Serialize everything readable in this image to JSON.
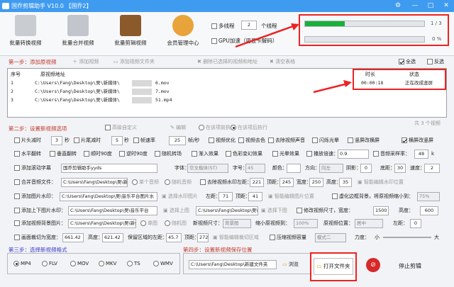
{
  "window": {
    "title": "国乔剪辑助手 V10.0   【国乔2】",
    "btn_settings": "⚙",
    "btn_min": "—",
    "btn_max": "□",
    "btn_close": "✕"
  },
  "toolbar": {
    "tools": [
      "批量转换视频",
      "批量合并视频",
      "批量剪辑视频",
      "会员管理中心"
    ],
    "multithread_label": "多线程",
    "thread_count": "2",
    "thread_unit": "个线程",
    "gpu_label": "GPU加速（用显卡解码）"
  },
  "progress": {
    "overall_fraction": 0.333,
    "overall_text": "1 / 3",
    "current_fraction": 0.0,
    "current_text": "0 %"
  },
  "step1": {
    "title": "第一步：添加原视频",
    "add_video": "添加视频",
    "add_folder": "添加视频文件夹",
    "delete_selected": "删除已选择的视频和地址",
    "clear_list": "清空表格",
    "select_all": "全选",
    "invert": "反选"
  },
  "list": {
    "headers": [
      "序号",
      "原视频地址",
      "时长",
      "状态"
    ],
    "rows": [
      {
        "index": "1",
        "path": "C:\\Users\\Fang\\Desktop\\吴\\新媒体\\",
        "suffix": "6.mov",
        "duration": "00:00:18",
        "status": "正在改成竖屏"
      },
      {
        "index": "2",
        "path": "C:\\Users\\Fang\\Desktop\\吴\\新媒体\\",
        "suffix": "7.mov",
        "duration": "",
        "status": ""
      },
      {
        "index": "3",
        "path": "C:\\Users\\Fang\\Desktop\\吴\\新媒体\\",
        "suffix": "51.mp4",
        "duration": "",
        "status": ""
      }
    ],
    "count_text": "共 3 个视频"
  },
  "step2": {
    "title": "第二步：设置新视频选项",
    "advanced": "高级自定义",
    "edit": "编辑",
    "before": "在该项前执行",
    "after": "在该项后执行"
  },
  "opts": {
    "cut_head": "片头减时",
    "cut_head_val": "3",
    "sec": "秒",
    "cut_tail": "片尾减时",
    "cut_tail_val": "5",
    "fps_label": "帧速率",
    "fps_val": "25",
    "fps_unit": "帧/秒",
    "optimize": "视频优化",
    "decolor": "视频去色",
    "remove_audio": "去除视频声音",
    "flash": "闪烁光晕",
    "portrait_h": "竖屏改横屏",
    "landscape_p": "横屏改竖屏",
    "hflip": "水平翻转",
    "vflip": "垂直翻转",
    "rot90cw": "顺时90度",
    "rot90ccw": "逆时90度",
    "rand_transition": "随机转场",
    "fade_in": "渐入效果",
    "color_change": "色彩变幻效果",
    "light_effect": "光晕效果",
    "speed_label": "播放倍速：",
    "speed_val": "0.9",
    "samplerate_label": "音频采样率：",
    "samplerate_val": "48",
    "samplerate_unit": "k",
    "scroll_sub": "添加滚动字幕",
    "scroll_text": "国乔剪辑助手yyds",
    "font_label": "字体：",
    "font_val": "华文楷体(ST)",
    "fontsize_label": "字号：",
    "fontsize_val": "45",
    "color_label": "颜色：",
    "dir_label": "方向：",
    "dir_val": "向左",
    "shadow_label": "阴影：",
    "shadow_val": "0",
    "bottom_label": "底距：",
    "bottom_val": "30",
    "speed2_label": "速度：",
    "speed2_val": "2",
    "merge_audio": "合并音频文件：",
    "merge_path": "C:\\Users\\Fang\\Desktop\\吴\\新媒",
    "single_audio": "单个音频",
    "random_audio": "随机音频",
    "remove_wm": "去除视频水印",
    "left_label": "左距：",
    "left_val": "221",
    "top_label": "顶距：",
    "top_val": "245",
    "width_label": "宽度：",
    "width_val": "250",
    "height_label": "高度：",
    "height_val": "35",
    "smart_wm": "智能编辑水印位置",
    "add_pic_wm": "添加图片水印：",
    "pic_wm_path": "C:\\Users\\Fang\\Desktop\\吴\\音乐平台图片水",
    "choose_wm": "选择水印图片",
    "wm_left": "71",
    "wm_top": "41",
    "smart_pic": "智能编辑图片位置",
    "blur_bg": "虚化边框背景，将原视频缩小到：",
    "blur_val": "75%",
    "add_ud_pic": "添加上下图片水印：",
    "ud_path": "C:\\Users\\Fang\\Desktop\\吴\\音乐平台",
    "choose_top": "选择上图",
    "choose_bottom": "选择下图",
    "modify_size": "修改视频尺寸，宽度：",
    "size_w": "1500",
    "size_h_label": "高度：",
    "size_h": "600",
    "add_bg_pic": "添加视频背景图片：",
    "bg_path": "C:\\Users\\Fang\\Desktop\\吴\\新媒体",
    "single_img": "单图",
    "random_img": "随机图",
    "new_size_label": "新视频尺寸：",
    "new_size_val": "背景图",
    "shrink_label": "缩小原视频到：",
    "shrink_val": "100%",
    "pos_label": "原视频位置：",
    "pos_val": "居中",
    "left2_label": "左距：",
    "left2_val": "0",
    "crop": "画面裁切为宽度：",
    "crop_w": "661.42",
    "crop_h_label": "高度：",
    "crop_h": "621.42",
    "keep_label": "保留区域的左距：",
    "keep_left": "45.7",
    "keep_top_label": "顶距：",
    "keep_top": "272",
    "smart_crop": "智能编辑裁切区域",
    "compress": "压缩视频容量",
    "mode_val": "模式二",
    "force_label": "力度：",
    "force_small": "小",
    "force_big": "大"
  },
  "step3": {
    "title": "第三步：选择新视频格式",
    "formats": [
      "MP4",
      "FLV",
      "MOV",
      "MKV",
      "TS",
      "WMV"
    ],
    "selected": 0
  },
  "step4": {
    "title": "第四步：设置新视频保存位置",
    "save_path": "C:\\Users\\Fang\\Desktop\\新建文件夹",
    "browse": "浏览",
    "open_folder": "打开文件夹",
    "stop": "停止剪辑"
  },
  "colors": {
    "titlebar": "#3f9bf0",
    "progress": "#19b03b",
    "highlight": "#e22222"
  }
}
